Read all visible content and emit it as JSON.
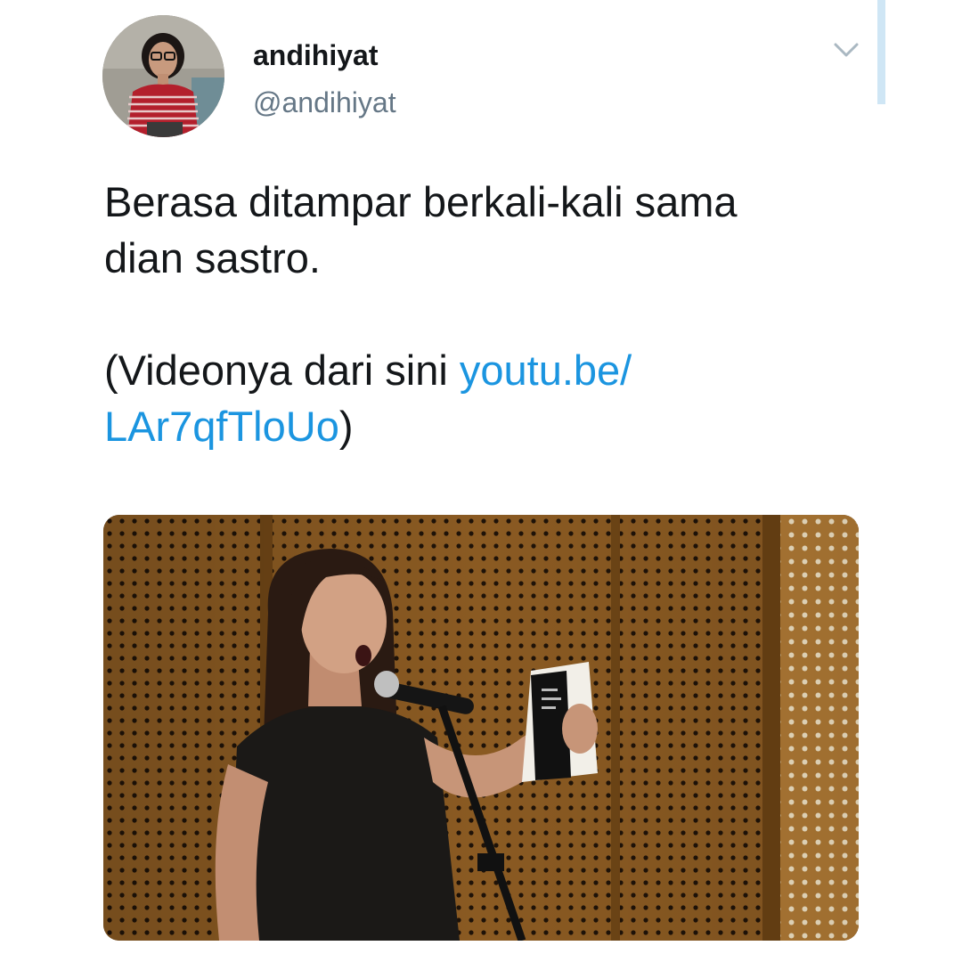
{
  "tweet": {
    "author": {
      "display_name": "andihiyat",
      "handle": "@andihiyat",
      "avatar_icon": "profile-photo"
    },
    "menu_icon": "chevron-down-icon",
    "text_line1": "Berasa ditampar berkali-kali sama",
    "text_line2": "dian sastro.",
    "text_para2_prefix": "(Videonya dari sini ",
    "link_part1": "youtu.be/",
    "link_part2": "LAr7qfTloUo",
    "text_para2_suffix": ")",
    "media": {
      "type": "video-thumbnail",
      "subject": "woman reading poetry at microphone"
    },
    "colors": {
      "link": "#1b95e0",
      "text": "#14171a",
      "secondary": "#657786"
    }
  }
}
